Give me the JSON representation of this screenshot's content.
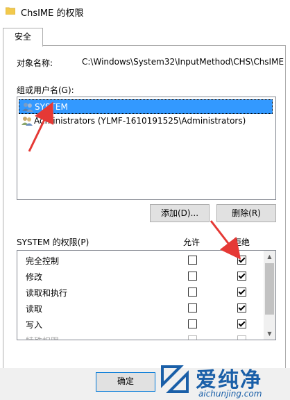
{
  "window": {
    "title": "ChsIME 的权限"
  },
  "tabs": [
    {
      "label": "安全"
    }
  ],
  "object": {
    "label": "对象名称:",
    "value": "C:\\Windows\\System32\\InputMethod\\CHS\\ChsIME"
  },
  "groups": {
    "label": "组或用户名(G):",
    "items": [
      {
        "label": "SYSTEM",
        "selected": true
      },
      {
        "label": "Administrators (YLMF-1610191525\\Administrators)",
        "selected": false
      }
    ]
  },
  "buttons": {
    "add": "添加(D)...",
    "remove": "删除(R)",
    "ok": "确定"
  },
  "permissions": {
    "title": "SYSTEM 的权限(P)",
    "allow_header": "允许",
    "deny_header": "拒绝",
    "rows": [
      {
        "name": "完全控制",
        "allow": false,
        "deny": true
      },
      {
        "name": "修改",
        "allow": false,
        "deny": true
      },
      {
        "name": "读取和执行",
        "allow": false,
        "deny": true
      },
      {
        "name": "读取",
        "allow": false,
        "deny": true
      },
      {
        "name": "写入",
        "allow": false,
        "deny": true
      },
      {
        "name": "特殊权限",
        "allow": false,
        "deny": false
      }
    ]
  },
  "watermark": {
    "name": "爱纯净",
    "url": "aichunjing.com"
  },
  "colors": {
    "selection": "#3399ff",
    "annotation_arrow": "#e53935",
    "watermark": "#1a5fa8"
  }
}
